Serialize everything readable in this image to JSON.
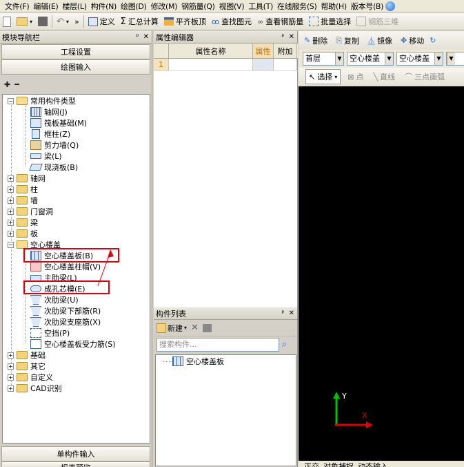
{
  "menu": [
    "文件(F)",
    "编辑(E)",
    "楼层(L)",
    "构件(N)",
    "绘图(D)",
    "修改(M)",
    "钢筋量(Q)",
    "视图(V)",
    "工具(T)",
    "在线服务(S)",
    "帮助(H)",
    "版本号(B)"
  ],
  "toolbar": {
    "define": "定义",
    "sum_calc": "汇总计算",
    "flat_slab_top": "平齐板顶",
    "find_element": "查找图元",
    "view_rebar": "查看钢筋量",
    "batch_select": "批量选择",
    "rebar_3d": "钢筋三维",
    "more": "»"
  },
  "nav": {
    "title": "模块导航栏",
    "project_settings": "工程设置",
    "drawing_input": "绘图输入",
    "single_component_input": "单构件输入",
    "report_preview": "报表预览"
  },
  "tree": {
    "common_types": "常用构件类型",
    "common_children": [
      "轴网(J)",
      "筏板基础(M)",
      "框柱(Z)",
      "剪力墙(Q)",
      "梁(L)",
      "现浇板(B)"
    ],
    "axis": "轴网",
    "column": "柱",
    "wall": "墙",
    "door_window": "门窗洞",
    "beam": "梁",
    "slab": "板",
    "hollow_slab": "空心楼盖",
    "hollow_children": [
      "空心楼盖板(B)",
      "空心楼盖柱帽(V)",
      "主肋梁(L)",
      "成孔芯模(E)",
      "次肋梁(U)",
      "次肋梁下部筋(R)",
      "次肋梁支座筋(X)",
      "空挡(P)",
      "空心楼盖板受力筋(S)"
    ],
    "foundation": "基础",
    "other": "其它",
    "custom": "自定义",
    "cad": "CAD识别"
  },
  "prop_editor": {
    "title": "属性编辑器",
    "col_name": "属性名称",
    "col_value": "属性",
    "col_extra": "附加",
    "row_number": "1"
  },
  "component_list": {
    "title": "构件列表",
    "new_button": "新建",
    "search_placeholder": "搜索构件...",
    "item": "空心楼盖板"
  },
  "canvas_toolbar": {
    "delete": "删除",
    "copy": "复制",
    "mirror": "镜像",
    "move": "移动",
    "floor": "首层",
    "category": "空心楼盖",
    "component": "空心楼盖",
    "select": "选择",
    "point": "点",
    "line": "直线",
    "arc": "三点画弧"
  },
  "status_tabs": [
    "正交",
    "对象捕捉",
    "动态输入"
  ],
  "axis_labels": {
    "y": "Y",
    "x": "X"
  },
  "colors": {
    "highlight": "#e00010",
    "axis_y": "#00c000",
    "axis_x": "#e00000"
  }
}
